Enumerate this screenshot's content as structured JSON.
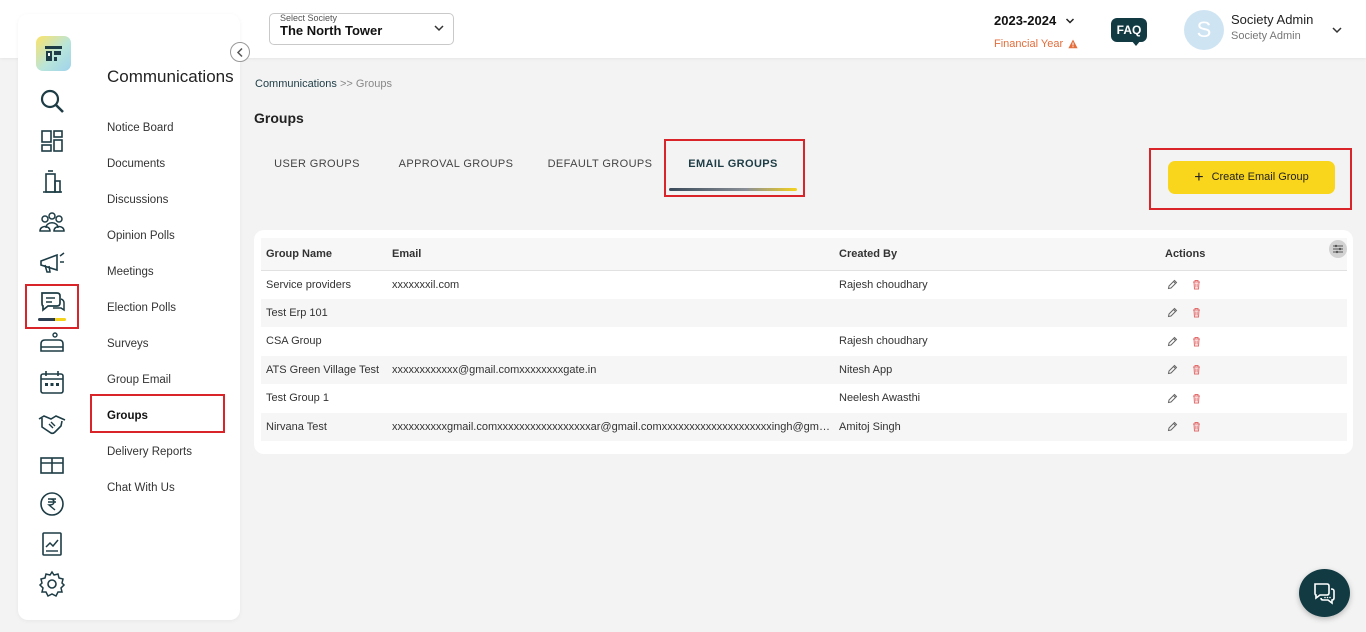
{
  "header": {
    "society_label": "Select Society",
    "society_value": "The North Tower",
    "year": "2023-2024",
    "financial_year_label": "Financial Year",
    "faq_label": "FAQ",
    "avatar_initial": "S",
    "user_name": "Society Admin",
    "user_role": "Society Admin"
  },
  "sidebar": {
    "section_title": "Communications",
    "rail_icons": [
      "logo-icon",
      "search-icon",
      "dashboard-icon",
      "building-icon",
      "members-icon",
      "announcement-icon",
      "communications-icon",
      "facility-icon",
      "calendar-icon",
      "handshake-icon",
      "parcel-icon",
      "rupee-icon",
      "report-icon",
      "settings-icon"
    ],
    "items": [
      {
        "label": "Notice Board"
      },
      {
        "label": "Documents"
      },
      {
        "label": "Discussions"
      },
      {
        "label": "Opinion Polls"
      },
      {
        "label": "Meetings"
      },
      {
        "label": "Election Polls"
      },
      {
        "label": "Surveys"
      },
      {
        "label": "Group Email"
      },
      {
        "label": "Groups"
      },
      {
        "label": "Delivery Reports"
      },
      {
        "label": "Chat With Us"
      }
    ],
    "active_item": "Groups"
  },
  "breadcrumb": {
    "parent": "Communications",
    "separator": ">>",
    "current": "Groups"
  },
  "page": {
    "title": "Groups",
    "tabs": [
      {
        "label": "USER GROUPS"
      },
      {
        "label": "APPROVAL GROUPS"
      },
      {
        "label": "DEFAULT GROUPS"
      },
      {
        "label": "EMAIL GROUPS"
      }
    ],
    "active_tab": "EMAIL GROUPS",
    "create_button": "Create Email Group"
  },
  "table": {
    "columns": [
      "Group Name",
      "Email",
      "Created By",
      "Actions"
    ],
    "rows": [
      {
        "name": "Service providers",
        "email": "xxxxxxxil.com",
        "created_by": "Rajesh choudhary"
      },
      {
        "name": "Test Erp 101",
        "email": "",
        "created_by": ""
      },
      {
        "name": "CSA Group",
        "email": "",
        "created_by": "Rajesh choudhary"
      },
      {
        "name": "ATS Green Village Test",
        "email": "xxxxxxxxxxxx@gmail.comxxxxxxxxgate.in",
        "created_by": "Nitesh App"
      },
      {
        "name": "Test Group 1",
        "email": "",
        "created_by": "Neelesh Awasthi"
      },
      {
        "name": "Nirvana Test",
        "email": "xxxxxxxxxxgmail.comxxxxxxxxxxxxxxxxxar@gmail.comxxxxxxxxxxxxxxxxxxxxingh@gmai...",
        "created_by": "Amitoj Singh"
      }
    ]
  },
  "colors": {
    "accent_yellow": "#f9d51c",
    "dark_teal": "#123a43",
    "highlight_red": "#d9252a",
    "delete_red": "#e36d6d",
    "warning_orange": "#e36d3b"
  }
}
